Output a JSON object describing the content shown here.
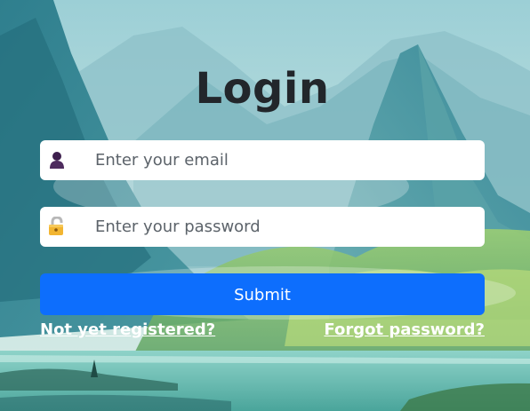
{
  "login": {
    "title": "Login",
    "email": {
      "placeholder": "Enter your email",
      "icon": "user-icon"
    },
    "password": {
      "placeholder": "Enter your password",
      "icon": "lock-icon"
    },
    "submit_label": "Submit",
    "register_link": "Not yet registered?",
    "forgot_link": "Forgot password?"
  },
  "colors": {
    "submit_button": "#0d6efd",
    "title_text": "#22262b",
    "link_text": "#ffffff",
    "field_background": "#ffffff"
  }
}
